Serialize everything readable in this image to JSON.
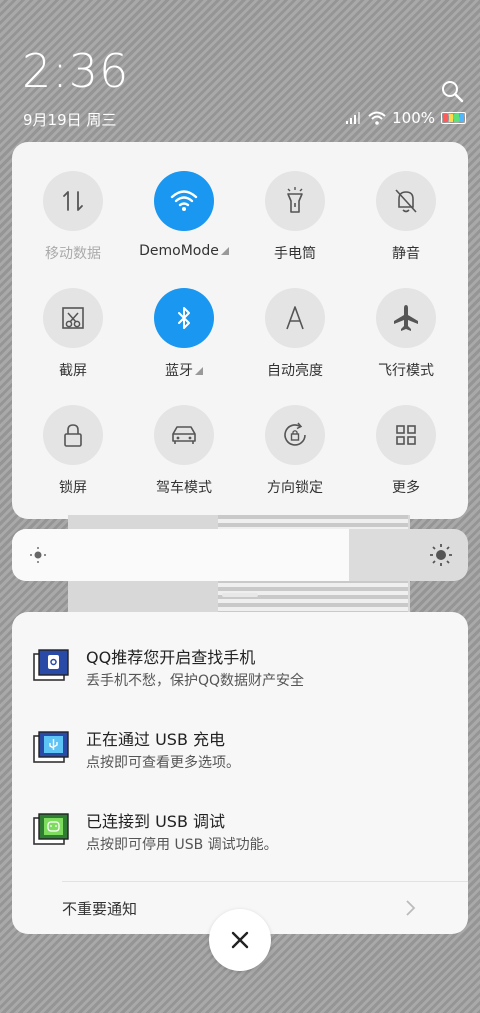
{
  "status": {
    "time": "2:36",
    "date": "9月19日 周三",
    "battery": "100%",
    "search_icon": "search-icon"
  },
  "quick_settings": [
    {
      "label": "移动数据",
      "icon": "mobile-data-icon",
      "active": false,
      "dim": true
    },
    {
      "label": "DemoMode",
      "icon": "wifi-icon",
      "active": true,
      "expand": true
    },
    {
      "label": "手电筒",
      "icon": "flashlight-icon",
      "active": false
    },
    {
      "label": "静音",
      "icon": "mute-bell-icon",
      "active": false
    },
    {
      "label": "截屏",
      "icon": "screenshot-icon",
      "active": false
    },
    {
      "label": "蓝牙",
      "icon": "bluetooth-icon",
      "active": true,
      "expand": true
    },
    {
      "label": "自动亮度",
      "icon": "auto-brightness-icon",
      "active": false
    },
    {
      "label": "飞行模式",
      "icon": "airplane-icon",
      "active": false
    },
    {
      "label": "锁屏",
      "icon": "lock-icon",
      "active": false
    },
    {
      "label": "驾车模式",
      "icon": "car-icon",
      "active": false
    },
    {
      "label": "方向锁定",
      "icon": "rotation-lock-icon",
      "active": false
    },
    {
      "label": "更多",
      "icon": "grid-icon",
      "active": false
    }
  ],
  "brightness": {
    "level": 0.74
  },
  "notifications": [
    {
      "title": "QQ推荐您开启查找手机",
      "subtitle": "丢手机不愁，保护QQ数据财产安全",
      "icon": "qq-find-phone-icon"
    },
    {
      "title": "正在通过 USB 充电",
      "subtitle": "点按即可查看更多选项。",
      "icon": "usb-icon"
    },
    {
      "title": "已连接到 USB 调试",
      "subtitle": "点按即可停用 USB 调试功能。",
      "icon": "android-debug-icon"
    }
  ],
  "unimportant_label": "不重要通知",
  "colors": {
    "accent": "#1a97f0",
    "panel": "#f5f5f5"
  }
}
